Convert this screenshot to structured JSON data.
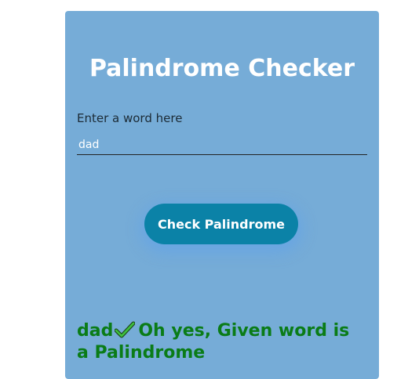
{
  "card": {
    "title": "Palindrome Checker",
    "input_label": "Enter a word here",
    "input_value": "dad",
    "button_label": "Check Palindrome"
  },
  "result": {
    "word": "dad",
    "icon": "checkmark-icon",
    "message": "Oh yes, Given word is a Palindrome"
  },
  "colors": {
    "card_background": "#76acd7",
    "button_background": "#0b82a7",
    "result_text": "#0a7c17",
    "check_icon": "#3fc23f"
  }
}
